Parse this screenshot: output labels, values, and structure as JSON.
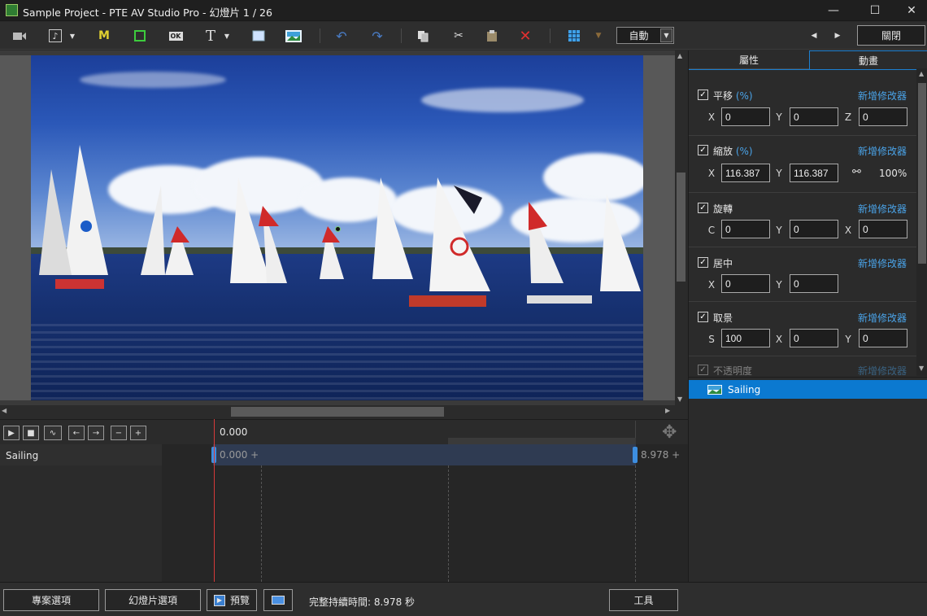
{
  "window": {
    "title": "Sample Project - PTE AV Studio Pro - 幻燈片 1 / 26",
    "minimize": "—",
    "maximize": "☐",
    "close": "✕"
  },
  "toolbar": {
    "music_label": "♪",
    "m_label": "M",
    "ok_label": "OK",
    "text_label": "T",
    "mode_value": "自動",
    "close_label": "關閉",
    "prev_arrow": "◀",
    "next_arrow": "▶"
  },
  "tabs": {
    "properties": "屬性",
    "animation": "動畫"
  },
  "props": {
    "pan": {
      "label": "平移",
      "unit": "(%)",
      "add": "新增修改器",
      "x": "0",
      "y": "0",
      "z": "0",
      "axes": [
        "X",
        "Y",
        "Z"
      ]
    },
    "zoom": {
      "label": "縮放",
      "unit": "(%)",
      "add": "新增修改器",
      "x": "116.387",
      "y": "116.387",
      "ratio": "100%",
      "axes": [
        "X",
        "Y"
      ]
    },
    "rotate": {
      "label": "旋轉",
      "add": "新增修改器",
      "c": "0",
      "y": "0",
      "x": "0",
      "axes": [
        "C",
        "Y",
        "X"
      ]
    },
    "center": {
      "label": "居中",
      "add": "新增修改器",
      "x": "0",
      "y": "0",
      "axes": [
        "X",
        "Y"
      ]
    },
    "crop": {
      "label": "取景",
      "add": "新增修改器",
      "s": "100",
      "x": "0",
      "y": "0",
      "axes": [
        "S",
        "X",
        "Y"
      ]
    },
    "opacity": {
      "label": "不透明度",
      "add": "新增修改器"
    }
  },
  "layers": [
    {
      "name": "Sailing",
      "selected": true
    }
  ],
  "timeline": {
    "current_time": "0.000",
    "track_name": "Sailing",
    "start": "0.000 +",
    "end": "8.978 +"
  },
  "bottom": {
    "project_options": "專案選項",
    "slide_options": "幻燈片選項",
    "preview": "預覽",
    "duration": "完整持續時間: 8.978 秒",
    "tools": "工具"
  },
  "colors": {
    "accent": "#0b79d0",
    "link": "#4aa3e8",
    "playhead": "#d63a3a"
  }
}
